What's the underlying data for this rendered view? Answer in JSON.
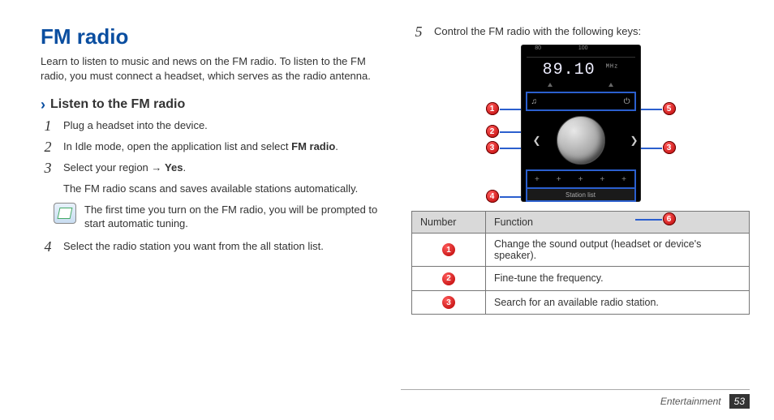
{
  "title": "FM radio",
  "intro": "Learn to listen to music and news on the FM radio. To listen to the FM radio, you must connect a headset, which serves as the radio antenna.",
  "subheading": "Listen to the FM radio",
  "steps": {
    "s1": "Plug a headset into the device.",
    "s2_pre": "In Idle mode, open the application list and select ",
    "s2_bold": "FM radio",
    "s2_post": ".",
    "s3_pre": "Select your region → ",
    "s3_bold": "Yes",
    "s3_post": ".",
    "s3_note1": "The FM radio scans and saves available stations automatically.",
    "s3_note2": "The first time you turn on the FM radio, you will be prompted to start automatic tuning.",
    "s4": "Select the radio station you want from the all station list.",
    "s5": "Control the FM radio with the following keys:"
  },
  "stepnums": {
    "n1": "1",
    "n2": "2",
    "n3": "3",
    "n4": "4",
    "n5": "5"
  },
  "radio": {
    "scale80": "80",
    "scale100": "100",
    "freq": "89.10",
    "mhz": "MHz",
    "station_list": "Station list"
  },
  "callouts": {
    "c1": "1",
    "c2": "2",
    "c3": "3",
    "c4": "4",
    "c5": "5",
    "c6": "6"
  },
  "table": {
    "head_num": "Number",
    "head_func": "Function",
    "rows": [
      {
        "num": "1",
        "func": "Change the sound output (headset or device's speaker)."
      },
      {
        "num": "2",
        "func": "Fine-tune the frequency."
      },
      {
        "num": "3",
        "func": "Search for an available radio station."
      }
    ]
  },
  "footer": {
    "section": "Entertainment",
    "page": "53"
  }
}
